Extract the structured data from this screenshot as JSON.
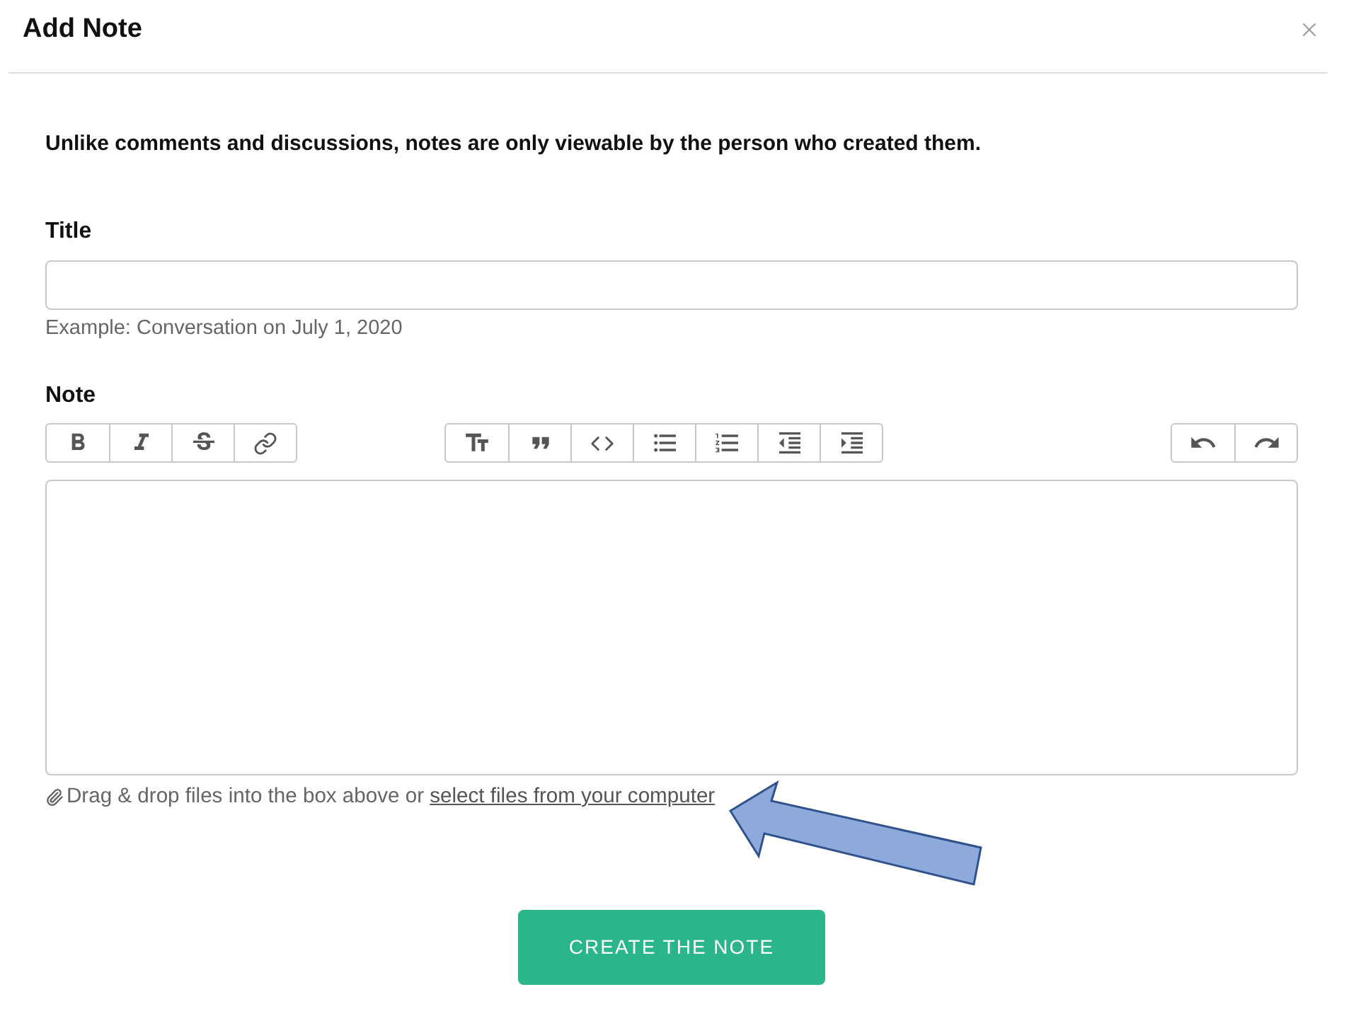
{
  "dialog": {
    "title": "Add Note"
  },
  "notice": "Unlike comments and discussions, notes are only viewable by the person who created them.",
  "title_field": {
    "label": "Title",
    "hint": "Example: Conversation on July 1, 2020"
  },
  "note_field": {
    "label": "Note"
  },
  "attachment": {
    "text": "Drag & drop files into the box above or",
    "link": "select files from your computer"
  },
  "submit_button": "CREATE THE NOTE"
}
